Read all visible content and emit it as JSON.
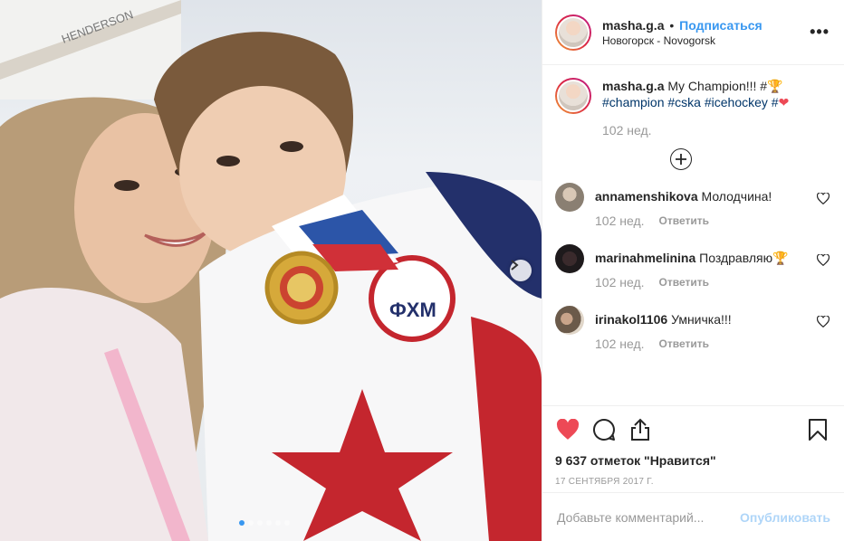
{
  "post": {
    "username": "masha.g.a",
    "separator": "•",
    "follow_label": "Подписаться",
    "location": "Новогорск - Novogorsk",
    "more_label": "•••",
    "caption_prefix": "My Champion!!! #",
    "caption_emoji": "🏆",
    "caption_tags": [
      "#champion",
      "#cska",
      "#icehockey",
      "#"
    ],
    "caption_heart": "❤",
    "caption_time": "102 нед.",
    "likes": "9 637 отметок \"Нравится\"",
    "date": "17 сентября 2017 г."
  },
  "comments": [
    {
      "username": "annamenshikova",
      "text": "Молодчина!",
      "time": "102 нед.",
      "reply": "Ответить",
      "avatar_color": "#8a7f72"
    },
    {
      "username": "marinahmelinina",
      "text": "Поздравляю🏆",
      "time": "102 нед.",
      "reply": "Ответить",
      "avatar_color": "#1e1a1c"
    },
    {
      "username": "irinakol1106",
      "text": "Умничка!!!",
      "time": "102 нед.",
      "reply": "Ответить",
      "avatar_color": "#6b5a4a"
    }
  ],
  "add_comment": {
    "placeholder": "Добавьте комментарий...",
    "publish_label": "Опубликовать"
  },
  "photo": {
    "rink_board_text": "HENDERSON",
    "carousel_dots": 6,
    "active_dot": 0
  },
  "colors": {
    "accent": "#3897f0",
    "like_red": "#ed4956",
    "hashtag": "#003569",
    "muted": "#999999"
  },
  "icons": {
    "like": "heart-icon",
    "comment": "comment-bubble-icon",
    "share": "share-icon",
    "save": "bookmark-icon",
    "add": "plus-circle-icon",
    "next": "chevron-right-icon"
  }
}
